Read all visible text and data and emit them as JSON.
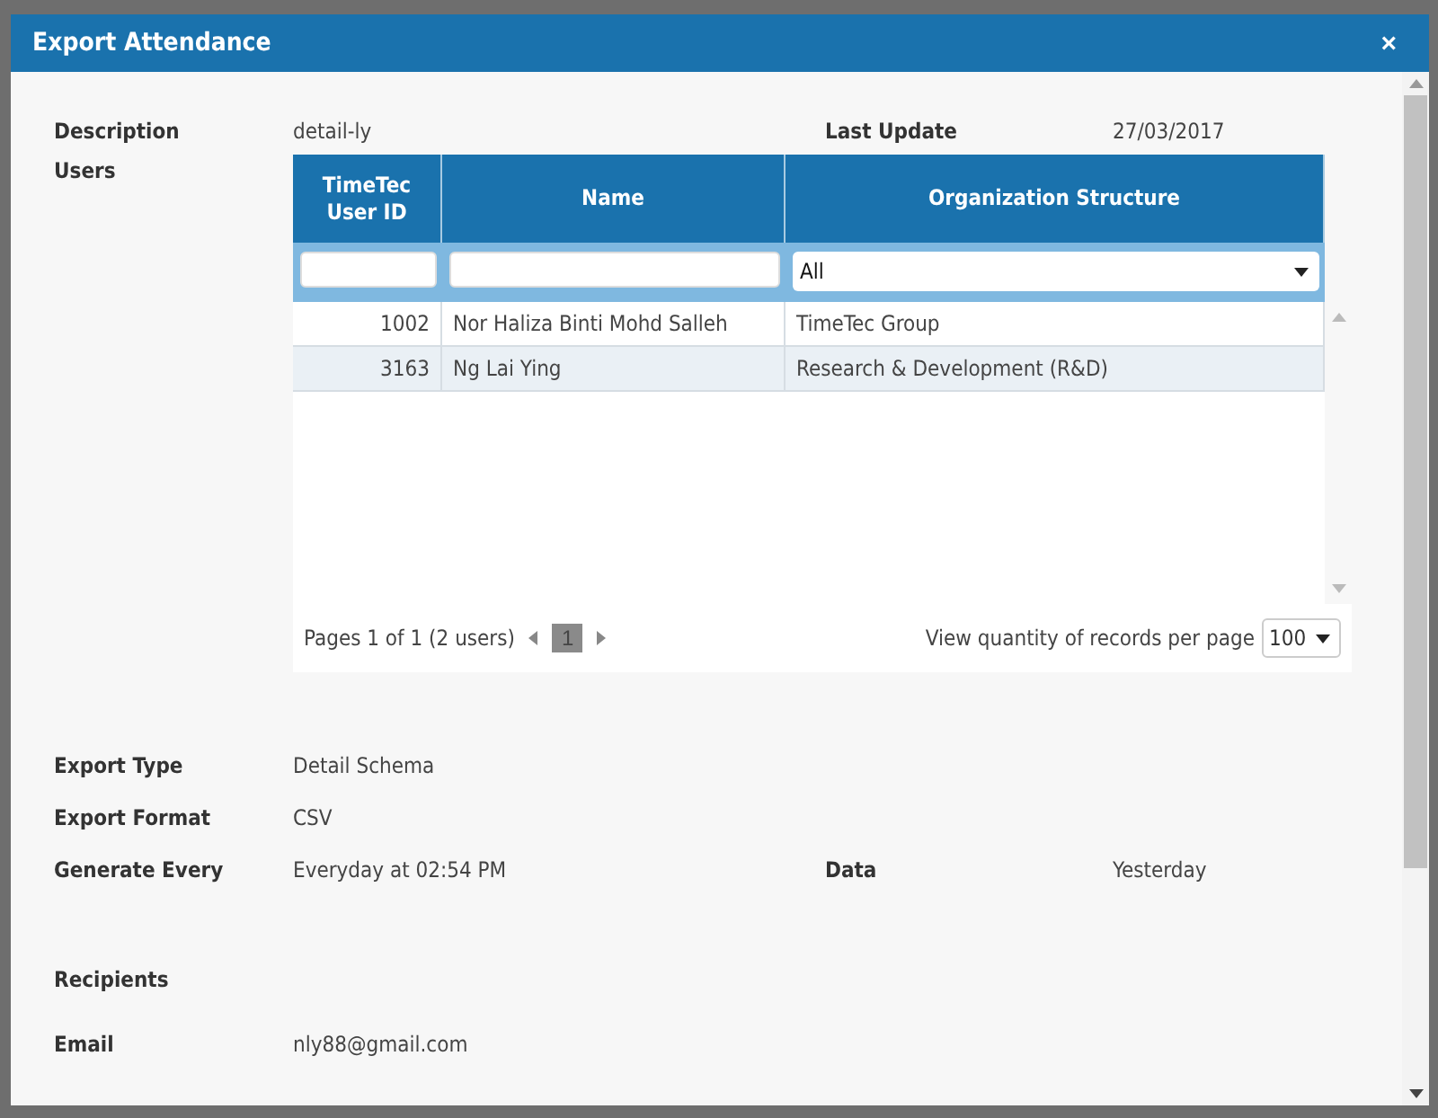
{
  "dialog": {
    "title": "Export Attendance",
    "close": "×"
  },
  "description": {
    "label": "Description",
    "value": "detail-ly"
  },
  "last_update": {
    "label": "Last Update",
    "value": "27/03/2017"
  },
  "users": {
    "label": "Users",
    "columns": [
      "TimeTec User ID",
      "Name",
      "Organization Structure"
    ],
    "filter_select": "All",
    "rows": [
      {
        "id": "1002",
        "name": "Nor Haliza Binti Mohd Salleh",
        "org": "TimeTec Group"
      },
      {
        "id": "3163",
        "name": "Ng Lai Ying",
        "org": "Research & Development (R&D)"
      }
    ],
    "pager": {
      "summary": "Pages 1 of 1 (2 users)",
      "pages": [
        {
          "label": "1",
          "selected": true
        }
      ],
      "per_page_label": "View quantity of records per page",
      "per_page": "100"
    }
  },
  "fields": [
    {
      "label": "Export Type",
      "value": "Detail Schema"
    },
    {
      "label": "Export Format",
      "value": "CSV"
    },
    {
      "label": "Generate Every",
      "value": "Everyday at 02:54 PM",
      "extra_label": "Data",
      "extra_value": "Yesterday"
    }
  ],
  "recipients": {
    "label": "Recipients"
  },
  "email": {
    "label": "Email",
    "value": "nly88@gmail.com"
  }
}
